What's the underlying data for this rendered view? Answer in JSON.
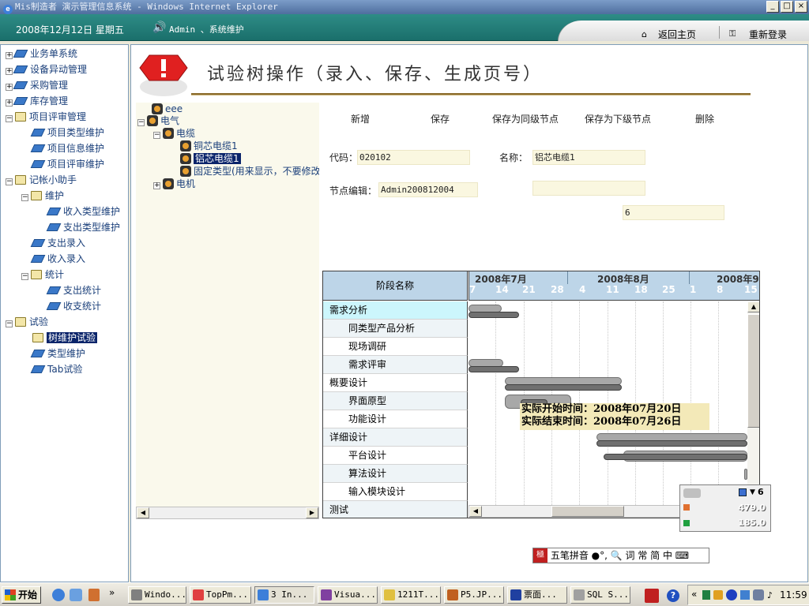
{
  "window": {
    "title": "Mis制造者  演示管理信息系统 - Windows Internet Explorer",
    "minimize": "_",
    "maximize": "□",
    "close": "×"
  },
  "header": {
    "date": "2008年12月12日  星期五",
    "user": "Admin 、系统维护",
    "home_link": "返回主页",
    "relogin_link": "重新登录"
  },
  "nav": {
    "items": [
      {
        "label": "业务单系统"
      },
      {
        "label": "设备异动管理"
      },
      {
        "label": "采购管理"
      },
      {
        "label": "库存管理"
      },
      {
        "label": "项目评审管理"
      },
      {
        "label": "项目类型维护"
      },
      {
        "label": "项目信息维护"
      },
      {
        "label": "项目评审维护"
      },
      {
        "label": "记帐小助手"
      },
      {
        "label": "维护"
      },
      {
        "label": "收入类型维护"
      },
      {
        "label": "支出类型维护"
      },
      {
        "label": "支出录入"
      },
      {
        "label": "收入录入"
      },
      {
        "label": "统计"
      },
      {
        "label": "支出统计"
      },
      {
        "label": "收支统计"
      },
      {
        "label": "试验"
      },
      {
        "label": "树维护试验"
      },
      {
        "label": "类型维护"
      },
      {
        "label": "Tab试验"
      }
    ]
  },
  "page": {
    "title": "试验树操作（录入、保存、生成页号）"
  },
  "tree": {
    "nodes": [
      {
        "label": "eee"
      },
      {
        "label": "电气"
      },
      {
        "label": "电缆"
      },
      {
        "label": "铜芯电缆1"
      },
      {
        "label": "铝芯电缆1"
      },
      {
        "label": "固定类型(用来显示，不要修改"
      },
      {
        "label": "电机"
      }
    ]
  },
  "toolbar": {
    "new": "新增",
    "save": "保存",
    "save_sibling": "保存为同级节点",
    "save_child": "保存为下级节点",
    "delete": "删除"
  },
  "form": {
    "code_label": "代码：",
    "code_value": "020102",
    "name_label": "名称：",
    "name_value": "铝芯电缆1",
    "editor_label": "节点编辑：",
    "editor_value": "Admin200812004",
    "blank_value": "",
    "page_value": "6"
  },
  "gantt": {
    "col_header": "阶段名称",
    "months": [
      "2008年7月",
      "2008年8月",
      "2008年9"
    ],
    "days": [
      "7",
      "14",
      "21",
      "28",
      "4",
      "11",
      "18",
      "25",
      "1",
      "8",
      "15"
    ],
    "rows": [
      {
        "label": "需求分析"
      },
      {
        "label": "同类型产品分析"
      },
      {
        "label": "现场调研"
      },
      {
        "label": "需求评审"
      },
      {
        "label": "概要设计"
      },
      {
        "label": "界面原型"
      },
      {
        "label": "功能设计"
      },
      {
        "label": "详细设计"
      },
      {
        "label": "平台设计"
      },
      {
        "label": "算法设计"
      },
      {
        "label": "输入模块设计"
      },
      {
        "label": "测试"
      }
    ],
    "tooltip": {
      "start": "实际开始时间：2008年07月20日",
      "end": "实际结束时间：2008年07月26日"
    }
  },
  "minipanel": {
    "count": "6",
    "value1": "479.0",
    "value2": "185.0"
  },
  "ime": {
    "label": "五笔拼音",
    "extras": "●°, 🔍 词 常 简 中 ⌨"
  },
  "taskbar": {
    "start": "开始",
    "buttons": [
      {
        "label": "Windo..."
      },
      {
        "label": "TopPm..."
      },
      {
        "label": "3 In..."
      },
      {
        "label": "Visua..."
      },
      {
        "label": "1211T..."
      },
      {
        "label": "P5.JP..."
      },
      {
        "label": "票面..."
      },
      {
        "label": "SQL S..."
      }
    ],
    "clock": "11:59"
  }
}
